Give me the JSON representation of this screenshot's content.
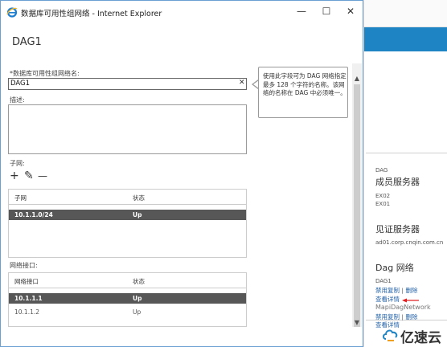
{
  "window": {
    "title": "数据库可用性组网络 - Internet Explorer",
    "minimize": "—",
    "maximize": "☐",
    "close": "✕"
  },
  "page_title": "DAG1",
  "form": {
    "name_label": "*数据库可用性组网络名:",
    "name_value": "DAG1",
    "clear_glyph": "✕",
    "desc_label": "描述:",
    "subnets_label": "子网:",
    "interfaces_label": "网络接口:"
  },
  "tooltip": "使用此字段可为 DAG 网络指定最多 128 个字符的名称。该网络的名称在 DAG 中必须唯一。",
  "toolbar": {
    "add": "+",
    "edit": "✎",
    "remove": "—"
  },
  "subnets": {
    "headers": [
      "子网",
      "状态"
    ],
    "rows": [
      {
        "name": "10.1.1.0/24",
        "status": "Up"
      }
    ]
  },
  "interfaces": {
    "headers": [
      "网络接口",
      "状态"
    ],
    "rows": [
      {
        "name": "10.1.1.1",
        "status": "Up"
      },
      {
        "name": "10.1.1.2",
        "status": "Up"
      }
    ]
  },
  "scroll": {
    "up": "▲",
    "down": "▼"
  },
  "background_panel": {
    "dag_label": "DAG",
    "members_heading": "成员服务器",
    "members": [
      "EX02",
      "EX01"
    ],
    "witness_heading": "见证服务器",
    "witness_value": "ad01.corp.cnqin.com.cn",
    "networks_heading": "Dag 网络",
    "net1_name": "DAG1",
    "net1_disable": "禁用复制",
    "net1_sep": "|",
    "net1_delete": "删除",
    "net1_details": "查看详情",
    "net2_name": "MapiDagNetwork",
    "net2_disable": "禁用复制",
    "net2_sep": "|",
    "net2_delete": "删除",
    "net2_details": "查看详情"
  },
  "watermark": "亿速云",
  "colors": {
    "accent": "#1f84c4",
    "selected_row": "#575757",
    "link": "#1f5fa6",
    "arrow": "#e02020"
  }
}
